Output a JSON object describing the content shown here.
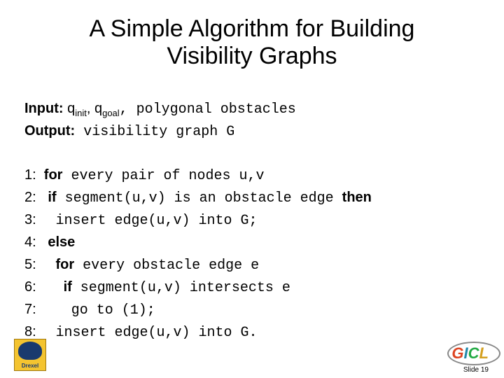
{
  "title_l1": "A Simple Algorithm for Building",
  "title_l2": "Visibility Graphs",
  "input_label": "Input:",
  "input_q1": "q",
  "input_q1s": "init",
  "input_sep1": ", ",
  "input_q2": "q",
  "input_q2s": "goal",
  "input_rest": ", polygonal obstacles",
  "output_label": "Output:",
  "output_text": " visibility graph G",
  "l1n": "1:  ",
  "l1k": "for",
  "l1t": " every pair of nodes u,v",
  "l2n": "2:   ",
  "l2k": "if",
  "l2t": " segment(u,v) is an obstacle edge ",
  "l2k2": "then",
  "l3n": "3:     ",
  "l3t": "insert edge(u,v) into G;",
  "l4n": "4:   ",
  "l4k": "else",
  "l5n": "5:     ",
  "l5k": "for",
  "l5t": " every obstacle edge e",
  "l6n": "6:       ",
  "l6k": "if",
  "l6t": " segment(u,v) intersects e",
  "l7n": "7:         ",
  "l7t": "go to (1);",
  "l8n": "8:     ",
  "l8t": "insert edge(u,v) into G.",
  "drexel": "Drexel",
  "slide_num": "Slide 19",
  "gicl": {
    "G": "G",
    "I": "I",
    "C": "C",
    "L": "L"
  }
}
